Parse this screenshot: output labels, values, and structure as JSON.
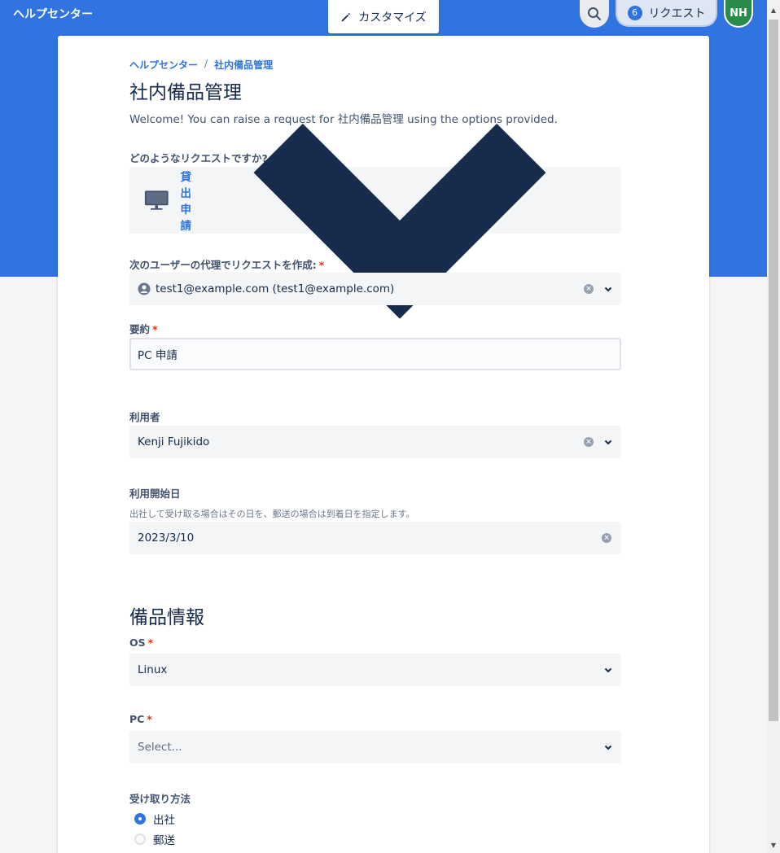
{
  "header": {
    "title": "ヘルプセンター",
    "customize_label": "カスタマイズ",
    "requests_label": "リクエスト",
    "requests_count": "6",
    "avatar_initials": "NH"
  },
  "breadcrumb": [
    "ヘルプセンター",
    "/",
    "社内備品管理"
  ],
  "page": {
    "title": "社内備品管理",
    "welcome": "Welcome! You can raise a request for 社内備品管理 using the options provided."
  },
  "form": {
    "request_type": {
      "label": "どのようなリクエストですか?",
      "value": "貸出申請",
      "icon": "monitor-icon"
    },
    "on_behalf": {
      "label": "次のユーザーの代理でリクエストを作成:",
      "required": "*",
      "value": "test1@example.com (test1@example.com)"
    },
    "summary": {
      "label": "要約",
      "required": "*",
      "value": "PC 申請"
    },
    "user": {
      "label": "利用者",
      "value": "Kenji Fujikido"
    },
    "start_date": {
      "label": "利用開始日",
      "help": "出社して受け取る場合はその日を、郵送の場合は到着日を指定します。",
      "value": "2023/3/10"
    },
    "equipment_section": "備品情報",
    "os": {
      "label": "OS",
      "required": "*",
      "value": "Linux"
    },
    "pc": {
      "label": "PC",
      "required": "*",
      "placeholder": "Select..."
    },
    "pickup": {
      "label": "受け取り方法",
      "options": [
        "出社",
        "郵送"
      ],
      "selected": "出社"
    }
  },
  "colors": {
    "brand": "#2f74e0",
    "required": "#de350b",
    "avatar": "#2a8a4a"
  }
}
